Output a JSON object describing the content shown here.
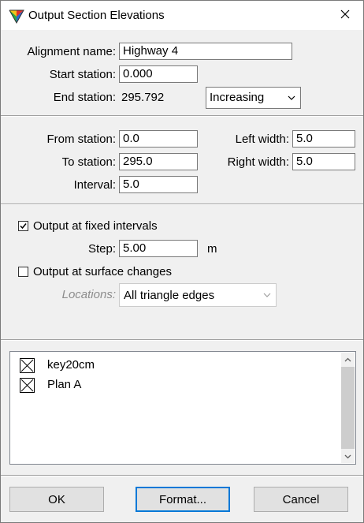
{
  "window": {
    "title": "Output Section Elevations"
  },
  "alignment": {
    "name_label": "Alignment name:",
    "name_value": "Highway 4",
    "start_label": "Start station:",
    "start_value": "0.000",
    "end_label": "End station:",
    "end_value": "295.792",
    "direction_value": "Increasing"
  },
  "range": {
    "from_label": "From station:",
    "from_value": "0.0",
    "to_label": "To station:",
    "to_value": "295.0",
    "interval_label": "Interval:",
    "interval_value": "5.0",
    "left_label": "Left width:",
    "left_value": "5.0",
    "right_label": "Right width:",
    "right_value": "5.0"
  },
  "output": {
    "fixed_label": "Output at fixed intervals",
    "fixed_checked": true,
    "step_label": "Step:",
    "step_value": "5.00",
    "step_unit": "m",
    "surface_label": "Output at surface changes",
    "surface_checked": false,
    "locations_label": "Locations:",
    "locations_value": "All triangle edges"
  },
  "surfaces": {
    "items": [
      {
        "label": "key20cm"
      },
      {
        "label": "Plan A"
      }
    ]
  },
  "buttons": {
    "ok": "OK",
    "format": "Format...",
    "cancel": "Cancel"
  },
  "icons": {
    "app": "app-triangle-icon",
    "close": "close-icon",
    "dropdown": "chevron-down-icon",
    "check": "checkmark-icon",
    "crossed_box": "crossed-box-icon",
    "scroll_up": "scroll-up-arrow-icon",
    "scroll_down": "scroll-down-arrow-icon"
  },
  "colors": {
    "default_button_border": "#0078d7",
    "panel": "#f0f0f0",
    "title_bar": "#ffffff"
  }
}
